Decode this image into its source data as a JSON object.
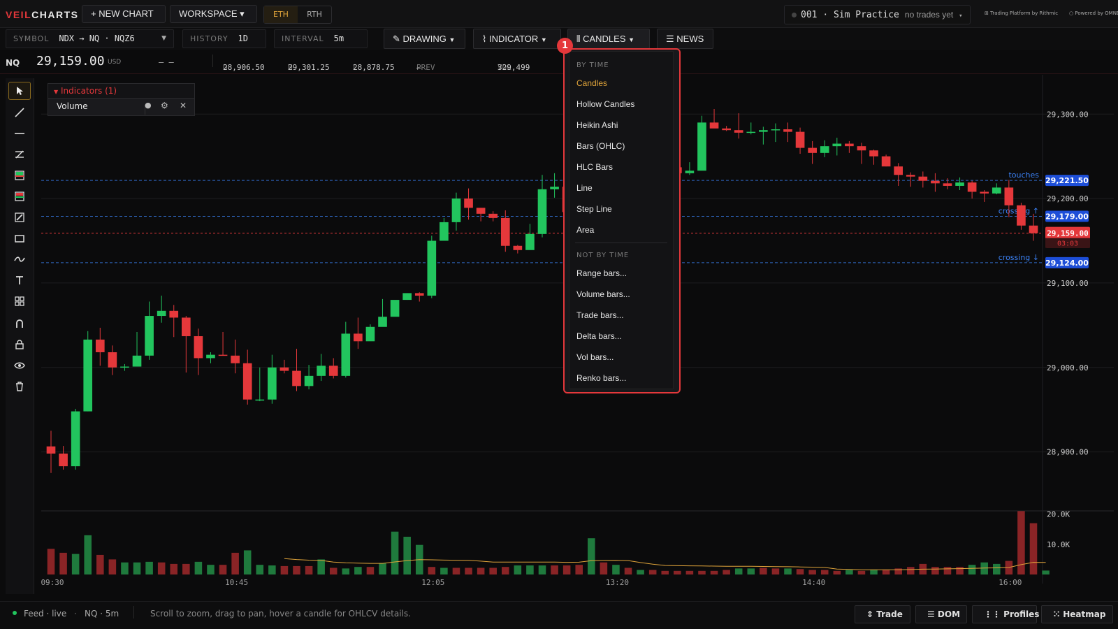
{
  "app": {
    "logo_part1": "VEIL",
    "logo_part2": "CHARTS",
    "new_chart_label": "+ NEW CHART",
    "workspace_label": "WORKSPACE ▾",
    "session_options": [
      "ETH",
      "RTH"
    ],
    "session_selected": "ETH"
  },
  "account": {
    "id": "001",
    "sep": "·",
    "name": "Sim Practice",
    "status": "no trades yet",
    "brand1": "Trading Platform by Rithmic",
    "brand2": "Powered by OMNE"
  },
  "toolbar": {
    "symbol_label": "SYMBOL",
    "symbol_value": "NDX → NQ · NQZ6",
    "history_label": "HISTORY",
    "history_value": "1D",
    "interval_label": "INTERVAL",
    "interval_value": "5m",
    "drawing_label": "DRAWING",
    "indicator_label": "INDICATOR",
    "candles_label": "CANDLES",
    "news_label": "NEWS"
  },
  "quote": {
    "symbol": "NQ",
    "price": "29,159.00",
    "currency": "USD",
    "change": "– –",
    "open_label": "O",
    "open": "28,906.50",
    "high_label": "H",
    "high": "29,301.25",
    "low_label": "L",
    "low": "28,878.75",
    "prev_label": "PREV",
    "prev": "–",
    "vol_label": "VOL",
    "vol": "329,499"
  },
  "indicators": {
    "header": "Indicators (1)",
    "items": [
      {
        "name": "Volume"
      }
    ]
  },
  "dropdown": {
    "marker": "1",
    "section1": "BY TIME",
    "by_time": [
      "Candles",
      "Hollow Candles",
      "Heikin Ashi",
      "Bars (OHLC)",
      "HLC Bars",
      "Line",
      "Step Line",
      "Area"
    ],
    "selected": "Candles",
    "section2": "NOT BY TIME",
    "not_by_time": [
      "Range bars...",
      "Volume bars...",
      "Trade bars...",
      "Delta bars...",
      "Vol bars...",
      "Renko bars..."
    ]
  },
  "chart_data": {
    "type": "candlestick",
    "price_ticks": [
      {
        "value": 29300,
        "label": "29,300.00"
      },
      {
        "value": 29200,
        "label": "29,200.00"
      },
      {
        "value": 29100,
        "label": "29,100.00"
      },
      {
        "value": 29000,
        "label": "29,000.00"
      },
      {
        "value": 28900,
        "label": "28,900.00"
      }
    ],
    "ylim": [
      28850,
      29330
    ],
    "time_ticks": [
      {
        "index": 0,
        "label": "09:30"
      },
      {
        "index": 15,
        "label": "10:45"
      },
      {
        "index": 31,
        "label": "12:05"
      },
      {
        "index": 46,
        "label": "13:20"
      },
      {
        "index": 62,
        "label": "14:40"
      },
      {
        "index": 78,
        "label": "16:00"
      }
    ],
    "volume_ticks": [
      {
        "value": 20000,
        "label": "20.0K"
      },
      {
        "value": 10000,
        "label": "10.0K"
      }
    ],
    "volume_max": 22000,
    "alert_lines": [
      {
        "value": 29221.5,
        "label": "29,221.50",
        "note": "touches"
      },
      {
        "value": 29179,
        "label": "29,179.00",
        "note": "crossing ↑"
      },
      {
        "value": 29124,
        "label": "29,124.00",
        "note": "crossing ↓"
      }
    ],
    "last_price": {
      "value": 29159,
      "label": "29,159.00",
      "countdown": "03:03"
    },
    "candles": [
      [
        28906.5,
        28898,
        28925,
        28875
      ],
      [
        28898,
        28883,
        28907,
        28879
      ],
      [
        28883,
        28948,
        28951,
        28879
      ],
      [
        28948,
        29033,
        29043,
        28948
      ],
      [
        29033,
        29018,
        29047,
        29002
      ],
      [
        29018,
        29000,
        29026,
        28991
      ],
      [
        29000,
        29001,
        29004,
        28996
      ],
      [
        29001,
        29014,
        29042,
        29012
      ],
      [
        29014,
        29061,
        29078,
        29009
      ],
      [
        29061,
        29067,
        29085,
        29053
      ],
      [
        29067,
        29059,
        29074,
        29036
      ],
      [
        29059,
        29037,
        29061,
        28994
      ],
      [
        29037,
        29011,
        29046,
        28991
      ],
      [
        29011,
        29015,
        29018,
        29005
      ],
      [
        29015,
        29014,
        29042,
        29014
      ],
      [
        29014,
        29005,
        29033,
        28993
      ],
      [
        29005,
        28962,
        29021,
        28956
      ],
      [
        28962,
        28962,
        29000,
        28960
      ],
      [
        28962,
        29000,
        29015,
        28957
      ],
      [
        29000,
        28996,
        29009,
        28993
      ],
      [
        28996,
        28978,
        29022,
        28972
      ],
      [
        28978,
        28990,
        29003,
        28974
      ],
      [
        28990,
        29002,
        29016,
        28984
      ],
      [
        29002,
        28990,
        29011,
        28987
      ],
      [
        28990,
        29040,
        29054,
        28988
      ],
      [
        29040,
        29031,
        29059,
        29022
      ],
      [
        29031,
        29048,
        29051,
        29032
      ],
      [
        29048,
        29060,
        29081,
        29050
      ],
      [
        29060,
        29080,
        29077,
        29069
      ],
      [
        29080,
        29088,
        29088,
        29080
      ],
      [
        29088,
        29085,
        29089,
        29078
      ],
      [
        29085,
        29150,
        29156,
        29082
      ],
      [
        29150,
        29172,
        29177,
        29164
      ],
      [
        29172,
        29200,
        29207,
        29162
      ],
      [
        29200,
        29189,
        29212,
        29175
      ],
      [
        29189,
        29182,
        29189,
        29173
      ],
      [
        29182,
        29177,
        29185,
        29173
      ],
      [
        29177,
        29144,
        29186,
        29137
      ],
      [
        29144,
        29139,
        29145,
        29135
      ],
      [
        29139,
        29158,
        29170,
        29153
      ],
      [
        29158,
        29211,
        29228,
        29154
      ],
      [
        29211,
        29214,
        29230,
        29201
      ],
      [
        29214,
        29184,
        29218,
        29184
      ],
      [
        29184,
        29183,
        29188,
        29170
      ],
      [
        29183,
        29180,
        29199,
        29173
      ],
      [
        29180,
        29192,
        29200,
        29181
      ],
      [
        29192,
        29206,
        29225,
        29200
      ],
      [
        29206,
        29250,
        29265,
        29215
      ],
      [
        29250,
        29245,
        29257,
        29227
      ],
      [
        29245,
        29247,
        29250,
        29226
      ],
      [
        29247,
        29237,
        29255,
        29232
      ],
      [
        29237,
        29230,
        29242,
        29225
      ],
      [
        29230,
        29233,
        29243,
        29228
      ],
      [
        29233,
        29290,
        29298,
        29285
      ],
      [
        29290,
        29283,
        29306,
        29286
      ],
      [
        29283,
        29281,
        29286,
        29280
      ],
      [
        29281,
        29278,
        29301,
        29271
      ],
      [
        29278,
        29279,
        29290,
        29276
      ],
      [
        29279,
        29281,
        29285,
        29264
      ],
      [
        29281,
        29282,
        29289,
        29267
      ],
      [
        29282,
        29279,
        29290,
        29267
      ],
      [
        29279,
        29260,
        29284,
        29253
      ],
      [
        29260,
        29254,
        29268,
        29241
      ],
      [
        29254,
        29262,
        29269,
        29249
      ],
      [
        29262,
        29265,
        29272,
        29251
      ],
      [
        29265,
        29262,
        29268,
        29254
      ],
      [
        29262,
        29257,
        29266,
        29241
      ],
      [
        29257,
        29250,
        29258,
        29240
      ],
      [
        29250,
        29238,
        29252,
        29238
      ],
      [
        29238,
        29228,
        29242,
        29215
      ],
      [
        29228,
        29226,
        29231,
        29214
      ],
      [
        29226,
        29221,
        29232,
        29213
      ],
      [
        29221,
        29218,
        29230,
        29208
      ],
      [
        29218,
        29215,
        29224,
        29211
      ],
      [
        29215,
        29219,
        29225,
        29210
      ],
      [
        29219,
        29208,
        29221,
        29200
      ],
      [
        29208,
        29206,
        29210,
        29196
      ],
      [
        29206,
        29213,
        29218,
        29205
      ],
      [
        29213,
        29192,
        29222,
        29178
      ],
      [
        29192,
        29168,
        29195,
        29163
      ],
      [
        29168,
        29159,
        29182,
        29150
      ]
    ],
    "volumes": [
      [
        8500,
        0
      ],
      [
        7200,
        0
      ],
      [
        6800,
        1
      ],
      [
        13000,
        1
      ],
      [
        6500,
        0
      ],
      [
        5000,
        0
      ],
      [
        4000,
        1
      ],
      [
        4000,
        1
      ],
      [
        4200,
        1
      ],
      [
        4000,
        0
      ],
      [
        3500,
        0
      ],
      [
        3500,
        0
      ],
      [
        4200,
        1
      ],
      [
        3200,
        1
      ],
      [
        3200,
        0
      ],
      [
        7200,
        0
      ],
      [
        8000,
        1
      ],
      [
        3200,
        1
      ],
      [
        3000,
        1
      ],
      [
        2800,
        0
      ],
      [
        2800,
        0
      ],
      [
        2800,
        0
      ],
      [
        5000,
        1
      ],
      [
        2200,
        0
      ],
      [
        2000,
        1
      ],
      [
        2500,
        1
      ],
      [
        2500,
        0
      ],
      [
        3800,
        1
      ],
      [
        14200,
        1
      ],
      [
        12500,
        1
      ],
      [
        9800,
        1
      ],
      [
        2500,
        0
      ],
      [
        2200,
        1
      ],
      [
        2200,
        0
      ],
      [
        2200,
        0
      ],
      [
        2200,
        0
      ],
      [
        2200,
        0
      ],
      [
        2500,
        0
      ],
      [
        3000,
        1
      ],
      [
        3000,
        1
      ],
      [
        3000,
        1
      ],
      [
        3000,
        0
      ],
      [
        3000,
        0
      ],
      [
        3200,
        0
      ],
      [
        12000,
        1
      ],
      [
        4000,
        0
      ],
      [
        3200,
        1
      ],
      [
        2200,
        0
      ],
      [
        1500,
        1
      ],
      [
        1500,
        0
      ],
      [
        1200,
        0
      ],
      [
        1200,
        0
      ],
      [
        1200,
        0
      ],
      [
        1200,
        0
      ],
      [
        1200,
        0
      ],
      [
        1500,
        0
      ],
      [
        2000,
        1
      ],
      [
        2000,
        1
      ],
      [
        2200,
        0
      ],
      [
        2000,
        0
      ],
      [
        2000,
        1
      ],
      [
        1800,
        0
      ],
      [
        1500,
        0
      ],
      [
        1500,
        0
      ],
      [
        1200,
        0
      ],
      [
        1500,
        1
      ],
      [
        1200,
        0
      ],
      [
        1500,
        1
      ],
      [
        1500,
        0
      ],
      [
        2000,
        0
      ],
      [
        2500,
        0
      ],
      [
        3500,
        0
      ],
      [
        2500,
        0
      ],
      [
        2500,
        0
      ],
      [
        2500,
        0
      ],
      [
        3200,
        1
      ],
      [
        4000,
        1
      ],
      [
        3500,
        1
      ],
      [
        4500,
        0
      ],
      [
        21000,
        0
      ],
      [
        17000,
        0
      ],
      [
        1300,
        1
      ]
    ],
    "colors": {
      "up": "#22c55e",
      "down": "#e5383b",
      "alert": "#3b82f6",
      "last": "#e5383b",
      "ma": "#e0a43a"
    }
  },
  "status": {
    "feed": "Feed · live",
    "sep": "·",
    "symbol_tf": "NQ · 5m",
    "hint": "Scroll to zoom, drag to pan, hover a candle for OHLCV details.",
    "buttons": [
      "⇕ Trade",
      "☰ DOM",
      "⋮⋮ Profiles",
      "⁙ Heatmap"
    ]
  }
}
